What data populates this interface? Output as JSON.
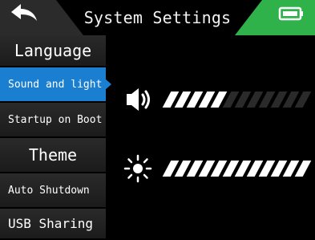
{
  "header": {
    "title": "System Settings"
  },
  "sidebar": {
    "items": [
      {
        "label": "Language"
      },
      {
        "label": "Sound and light"
      },
      {
        "label": "Startup on Boot"
      },
      {
        "label": "Theme"
      },
      {
        "label": "Auto Shutdown"
      },
      {
        "label": "USB Sharing"
      }
    ],
    "selected": "Sound and light"
  },
  "settings": {
    "volume": {
      "icon": "speaker-icon",
      "level": 5,
      "max": 12
    },
    "brightness": {
      "icon": "sun-icon",
      "level": 12,
      "max": 12
    }
  },
  "colors": {
    "accent": "#1a7fd0",
    "battery": "#2fb24a",
    "tab": "#2b2b2b"
  }
}
